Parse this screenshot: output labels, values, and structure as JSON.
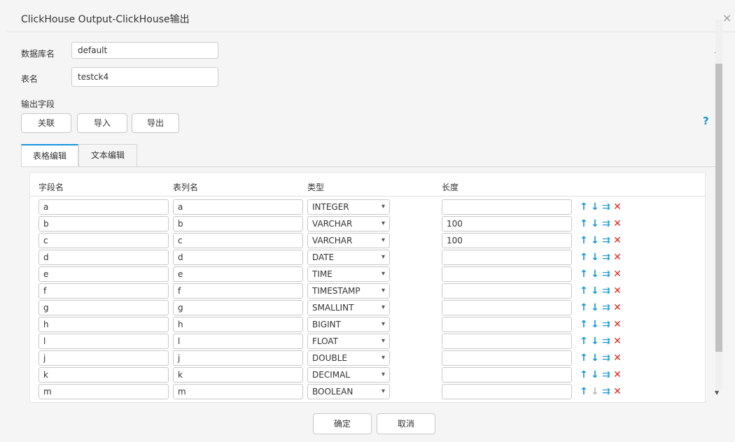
{
  "dialog": {
    "title": "ClickHouse Output-ClickHouse输出",
    "close_label": "×"
  },
  "form": {
    "db_label": "数据库名",
    "db_value": "default",
    "table_label": "表名",
    "table_value": "testck4",
    "fields_label": "输出字段"
  },
  "toolbar": {
    "link_label": "关联",
    "import_label": "导入",
    "export_label": "导出",
    "help_label": "?"
  },
  "tabs": [
    {
      "label": "表格编辑",
      "active": true
    },
    {
      "label": "文本编辑",
      "active": false
    }
  ],
  "table": {
    "headers": [
      "字段名",
      "表列名",
      "类型",
      "长度"
    ],
    "rows": [
      {
        "field": "a",
        "column": "a",
        "type": "INTEGER",
        "length": ""
      },
      {
        "field": "b",
        "column": "b",
        "type": "VARCHAR",
        "length": "100"
      },
      {
        "field": "c",
        "column": "c",
        "type": "VARCHAR",
        "length": "100"
      },
      {
        "field": "d",
        "column": "d",
        "type": "DATE",
        "length": ""
      },
      {
        "field": "e",
        "column": "e",
        "type": "TIME",
        "length": ""
      },
      {
        "field": "f",
        "column": "f",
        "type": "TIMESTAMP",
        "length": ""
      },
      {
        "field": "g",
        "column": "g",
        "type": "SMALLINT",
        "length": ""
      },
      {
        "field": "h",
        "column": "h",
        "type": "BIGINT",
        "length": ""
      },
      {
        "field": "l",
        "column": "l",
        "type": "FLOAT",
        "length": ""
      },
      {
        "field": "j",
        "column": "j",
        "type": "DOUBLE",
        "length": ""
      },
      {
        "field": "k",
        "column": "k",
        "type": "DECIMAL",
        "length": ""
      },
      {
        "field": "m",
        "column": "m",
        "type": "BOOLEAN",
        "length": ""
      }
    ]
  },
  "footer": {
    "ok_label": "确定",
    "cancel_label": "取消"
  },
  "icons": {
    "up": "arrow-up-icon",
    "down": "arrow-down-icon",
    "insert": "insert-row-icon",
    "delete": "delete-icon"
  },
  "colors": {
    "accent": "#1296db",
    "danger": "#e0251c"
  }
}
